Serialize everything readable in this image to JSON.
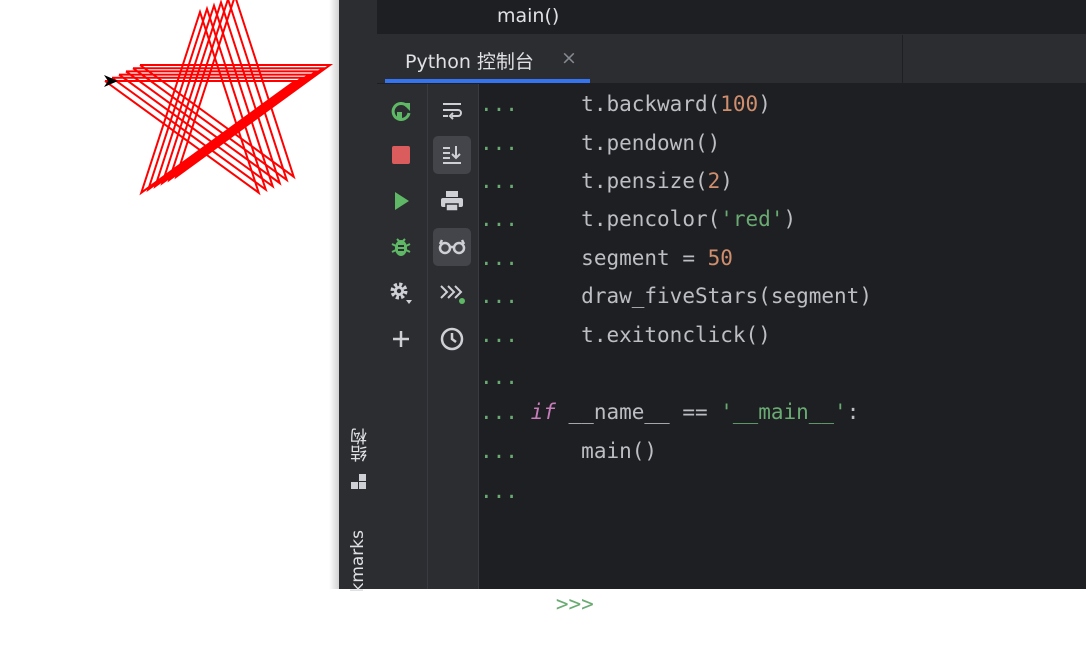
{
  "left_panel": {
    "icon": "turtle-star-drawing",
    "pen_color": "#ff0000"
  },
  "breadcrumb": {
    "text": "main()"
  },
  "side_strip": {
    "structure_label": "结构",
    "bookmarks_label": "kmarks"
  },
  "tab": {
    "label": "Python 控制台",
    "close": "×"
  },
  "toolbar_left": [
    "rerun-icon",
    "stop-icon",
    "run-icon",
    "debug-icon",
    "settings-icon",
    "add-icon"
  ],
  "toolbar_right": [
    "soft-wrap-icon",
    "scroll-to-end-icon",
    "print-icon",
    "show-variables-icon",
    "execute-icon",
    "history-icon"
  ],
  "colors": {
    "background": "#1e1f22",
    "panel": "#2b2d30",
    "text": "#bcbec4",
    "prompt": "#6aab73",
    "number": "#cf8e6d",
    "string": "#6aab73",
    "keyword": "#c77dbb",
    "tab_underline": "#3574f0"
  },
  "console": {
    "continuation_prompt": "...",
    "lines": [
      {
        "indent": "    ",
        "pre": "t.backward(",
        "lit": "100",
        "lit_type": "num",
        "post": ")"
      },
      {
        "indent": "    ",
        "pre": "t.pendown()",
        "lit": "",
        "lit_type": "",
        "post": ""
      },
      {
        "indent": "    ",
        "pre": "t.pensize(",
        "lit": "2",
        "lit_type": "num",
        "post": ")"
      },
      {
        "indent": "    ",
        "pre": "t.pencolor(",
        "lit": "'red'",
        "lit_type": "str",
        "post": ")"
      },
      {
        "indent": "    ",
        "pre": "segment = ",
        "lit": "50",
        "lit_type": "num",
        "post": ""
      },
      {
        "indent": "    ",
        "pre": "draw_fiveStars(segment)",
        "lit": "",
        "lit_type": "",
        "post": ""
      },
      {
        "indent": "    ",
        "pre": "t.exitonclick()",
        "lit": "",
        "lit_type": "",
        "post": ""
      },
      {
        "indent": "",
        "pre": "",
        "lit": "",
        "lit_type": "",
        "post": ""
      },
      {
        "indent": "",
        "kw": "if",
        "pre": " __name__ == ",
        "lit": "'__main__'",
        "lit_type": "str",
        "post": ":"
      },
      {
        "indent": "    ",
        "pre": "main()",
        "lit": "",
        "lit_type": "",
        "post": ""
      },
      {
        "indent": "",
        "pre": "",
        "lit": "",
        "lit_type": "",
        "post": ""
      }
    ],
    "input_prompt": ">>>"
  }
}
